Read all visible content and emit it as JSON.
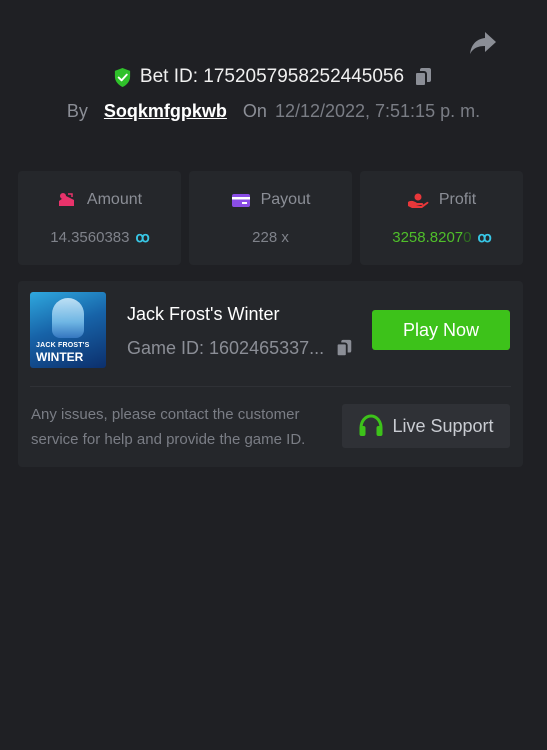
{
  "header": {
    "bet_id_label": "Bet ID: 1752057958252445056",
    "by_label": "By",
    "username": "Soqkmfgpkwb",
    "on_label": "On",
    "date": "12/12/2022, 7:51:15 p. m."
  },
  "stats": {
    "amount": {
      "label": "Amount",
      "value": "14.3560383",
      "currency_symbol": "ꝏ"
    },
    "payout": {
      "label": "Payout",
      "value": "228 x"
    },
    "profit": {
      "label": "Profit",
      "value": "3258.8207",
      "value_faded": "0",
      "currency_symbol": "ꝏ"
    }
  },
  "game": {
    "thumb_line1": "JACK FROST'S",
    "thumb_line2": "WINTER",
    "title": "Jack Frost's Winter",
    "game_id": "Game ID: 1602465337...",
    "play_label": "Play Now"
  },
  "support": {
    "text": "Any issues, please contact the customer service for help and provide the game ID.",
    "button_label": "Live Support"
  },
  "colors": {
    "background": "#1f2024",
    "card": "#25272b",
    "accent_green": "#3dc21a",
    "amount_icon": "#e8336b",
    "payout_icon": "#8a4de6",
    "profit_icon": "#e8373a",
    "coin": "#38c7e6"
  },
  "icons": {
    "share": "share-icon",
    "shield": "shield-check-icon",
    "copy": "copy-icon",
    "amount": "amount-icon",
    "payout": "card-icon",
    "profit": "profit-icon",
    "headset": "headset-icon"
  }
}
